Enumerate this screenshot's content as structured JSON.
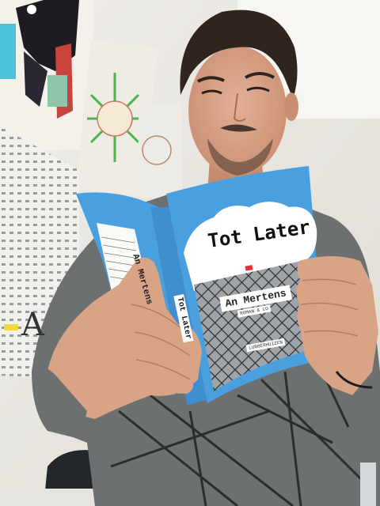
{
  "scene": {
    "description_colors": {
      "wall": "#e9e7e2",
      "book_cover_sky": "#4aa0df",
      "shirt": "#6e7172",
      "skin": "#d9a386",
      "hair": "#2f241e"
    }
  },
  "book": {
    "title": "Tot Later",
    "author": "An Mertens",
    "subtitle": "ROMAN & CO",
    "publisher": "LUBBERHUIZEN",
    "spine_author": "An Mertens",
    "spine_title": "Tot Later"
  },
  "poster": {
    "letter": "A"
  }
}
